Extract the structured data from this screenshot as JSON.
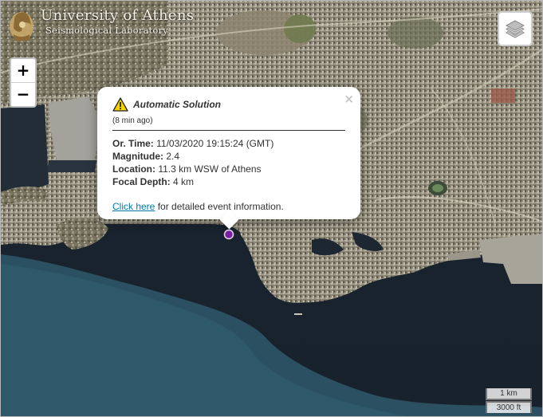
{
  "logo": {
    "title": "University of Athens",
    "subtitle": "Seismological Laboratory",
    "icon": "athena-seal-icon"
  },
  "zoom": {
    "in_label": "+",
    "out_label": "−"
  },
  "layers": {
    "icon": "layers-icon"
  },
  "popup": {
    "title": "Automatic Solution",
    "age": "(8 min ago)",
    "close_label": "×",
    "rows": [
      {
        "label": "Or. Time:",
        "value": "11/03/2020 19:15:24 (GMT)"
      },
      {
        "label": "Magnitude:",
        "value": "2.4"
      },
      {
        "label": "Location:",
        "value": "11.3 km WSW of Athens"
      },
      {
        "label": "Focal Depth:",
        "value": "4 km"
      }
    ],
    "link_text": "Click here",
    "link_suffix": "for detailed event information.",
    "icon": "warning-icon"
  },
  "marker": {
    "color": "#7b1fa2",
    "icon": "earthquake-marker-icon"
  },
  "scale": {
    "metric": "1 km",
    "imperial": "3000 ft"
  },
  "colors": {
    "sea_shallow": "#1e2a36",
    "sea_deep": "#2e5566",
    "land": "#7a7460",
    "link": "#0078a8"
  }
}
